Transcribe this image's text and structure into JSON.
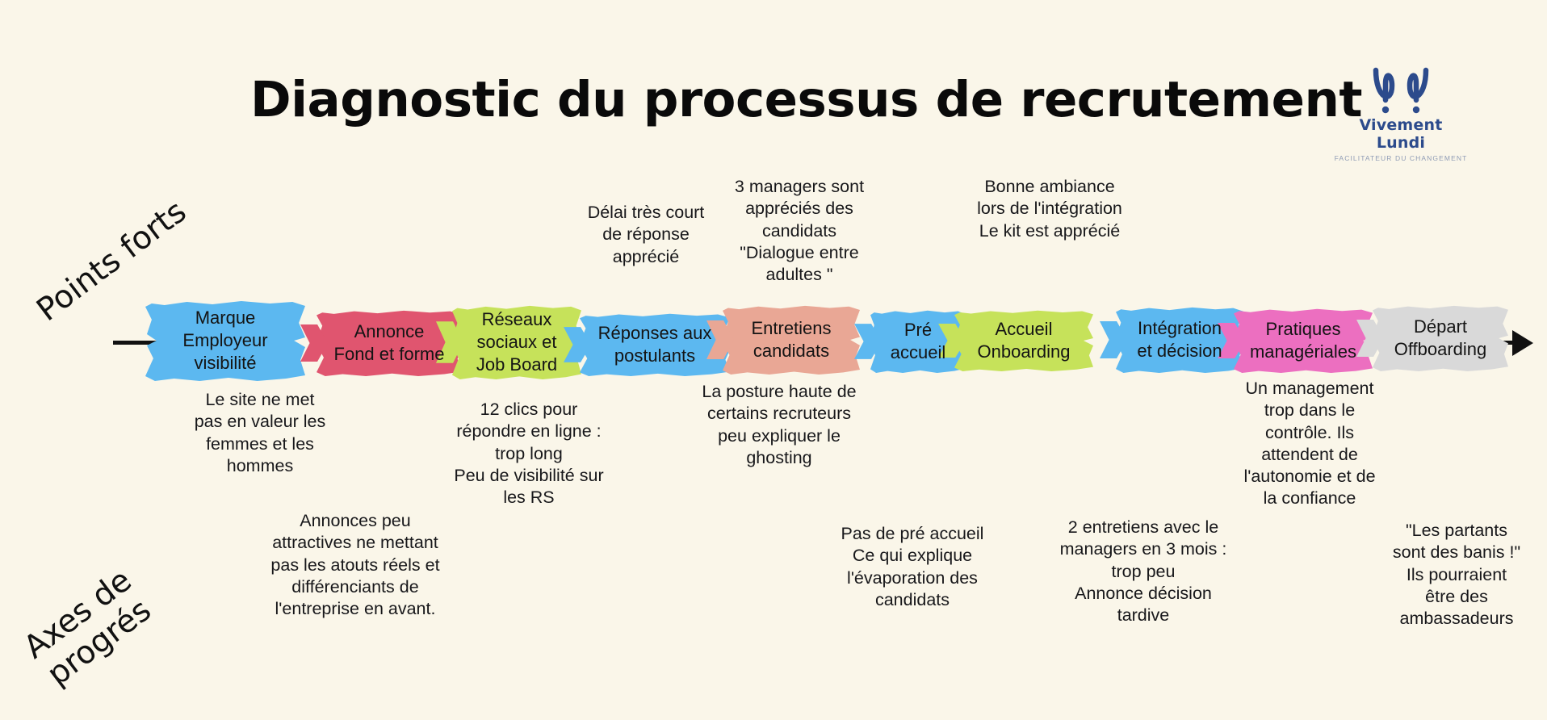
{
  "page": {
    "title": "Diagnostic du processus de recrutement",
    "background_color": "#FAF6E9"
  },
  "logo": {
    "icon": "double-loop-icon",
    "brand": "Vivement Lundi",
    "tagline": "FACILITATEUR DU CHANGEMENT",
    "color": "#2C4B8C"
  },
  "side_labels": {
    "strengths": "Points forts",
    "improvements": "Axes de\nprogrés"
  },
  "process": {
    "arrow_color": "#111111",
    "steps": [
      {
        "id": "marque-employeur",
        "label": "Marque\nEmployeur\nvisibilité",
        "color": "#5CB8F0"
      },
      {
        "id": "annonce",
        "label": "Annonce\nFond et forme",
        "color": "#E0556F"
      },
      {
        "id": "reseaux-sociaux",
        "label": "Réseaux\nsociaux et\nJob Board",
        "color": "#C6E25A"
      },
      {
        "id": "reponses",
        "label": "Réponses aux\npostulants",
        "color": "#5CB8F0"
      },
      {
        "id": "entretiens",
        "label": "Entretiens\ncandidats",
        "color": "#E9A795"
      },
      {
        "id": "pre-accueil",
        "label": "Pré\naccueil",
        "color": "#5CB8F0"
      },
      {
        "id": "accueil",
        "label": "Accueil\nOnboarding",
        "color": "#C6E25A"
      },
      {
        "id": "integration",
        "label": "Intégration\net décision",
        "color": "#5CB8F0"
      },
      {
        "id": "pratiques",
        "label": "Pratiques\nmanagériales",
        "color": "#EC6FC0"
      },
      {
        "id": "depart",
        "label": "Départ\nOffboarding",
        "color": "#D9D9D9"
      }
    ]
  },
  "strength_notes": [
    {
      "id": "note-delai",
      "text": "Délai très court\nde réponse\napprécié"
    },
    {
      "id": "note-managers",
      "text": "3 managers sont\nappréciés des\ncandidats\n\"Dialogue entre\nadultes \""
    },
    {
      "id": "note-ambiance",
      "text": "Bonne ambiance\nlors de l'intégration\nLe kit est apprécié"
    }
  ],
  "improvement_notes": [
    {
      "id": "note-site",
      "text": "Le site ne met\npas en valeur les\nfemmes et les\nhommes"
    },
    {
      "id": "note-annonces",
      "text": "Annonces peu\nattractives ne mettant\npas les atouts réels et\ndifférenciants de\nl'entreprise en avant."
    },
    {
      "id": "note-clics",
      "text": "12 clics pour\nrépondre en ligne :\ntrop long\nPeu de visibilité sur\nles RS"
    },
    {
      "id": "note-posture",
      "text": "La posture haute de\ncertains recruteurs\npeu expliquer le\nghosting"
    },
    {
      "id": "note-pre-accueil",
      "text": "Pas de pré accueil\nCe qui explique\nl'évaporation des\ncandidats"
    },
    {
      "id": "note-entretiens",
      "text": "2 entretiens avec le\nmanagers en 3 mois :\ntrop peu\nAnnonce décision\ntardive"
    },
    {
      "id": "note-management",
      "text": "Un management\ntrop dans le\ncontrôle. Ils\nattendent de\nl'autonomie et de\nla confiance"
    },
    {
      "id": "note-partants",
      "text": "\"Les partants\nsont des banis !\"\nIls pourraient\nêtre des\nambassadeurs"
    }
  ]
}
